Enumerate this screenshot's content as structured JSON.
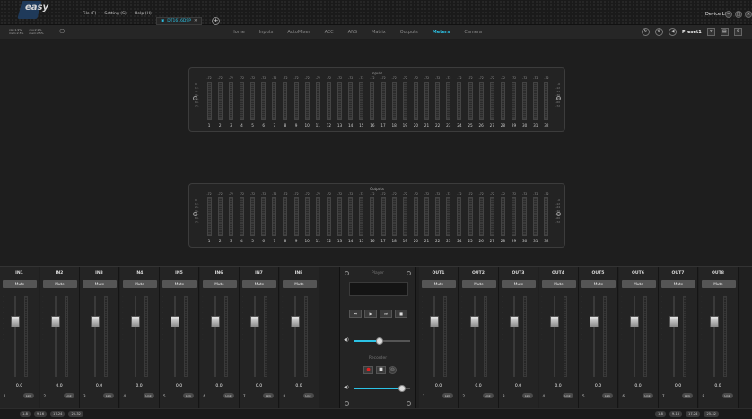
{
  "app": {
    "logo": "easy",
    "menus": [
      "File (F)",
      "Setting (S)",
      "Help (H)"
    ],
    "device_tab": "DT1616DSP",
    "device_list": "Device List"
  },
  "stats": {
    "cpu": "cpu:1.9%",
    "mem": "mem:2.5%",
    "cpu2": "cpu:2.9%",
    "mem2": "mem:2.5%"
  },
  "nav": {
    "tabs": [
      "Home",
      "Inputs",
      "AutoMixer",
      "AEC",
      "ANS",
      "Matrix",
      "Outputs",
      "Meters",
      "Camera"
    ],
    "active_tab": "Meters",
    "preset": "Preset1"
  },
  "meters": {
    "inputs_title": "Inputs",
    "outputs_title": "Outputs",
    "channel_value": "-72",
    "channel_count": 32,
    "scale_left": [
      "0-",
      "12-",
      "24-",
      "36-",
      "48-",
      "60-",
      "72-"
    ],
    "scale_right": [
      "-0",
      "-12",
      "-24",
      "-36",
      "-48",
      "-60",
      "-72"
    ]
  },
  "inputs": [
    {
      "name": "IN1",
      "value": "0.0",
      "num": "1"
    },
    {
      "name": "IN2",
      "value": "0.0",
      "num": "2"
    },
    {
      "name": "IN3",
      "value": "0.0",
      "num": "3"
    },
    {
      "name": "IN4",
      "value": "0.0",
      "num": "4"
    },
    {
      "name": "IN5",
      "value": "0.0",
      "num": "5"
    },
    {
      "name": "IN6",
      "value": "0.0",
      "num": "6"
    },
    {
      "name": "IN7",
      "value": "0.0",
      "num": "7"
    },
    {
      "name": "IN8",
      "value": "0.0",
      "num": "8"
    }
  ],
  "outputs": [
    {
      "name": "OUT1",
      "value": "0.0",
      "num": "1"
    },
    {
      "name": "OUT2",
      "value": "0.0",
      "num": "2"
    },
    {
      "name": "OUT3",
      "value": "0.0",
      "num": "3"
    },
    {
      "name": "OUT4",
      "value": "0.0",
      "num": "4"
    },
    {
      "name": "OUT5",
      "value": "0.0",
      "num": "5"
    },
    {
      "name": "OUT6",
      "value": "0.0",
      "num": "6"
    },
    {
      "name": "OUT7",
      "value": "0.0",
      "num": "7"
    },
    {
      "name": "OUT8",
      "value": "0.0",
      "num": "8"
    }
  ],
  "mute_label": "Mute",
  "link_label": "Link",
  "player": {
    "title": "Player",
    "volume": 0.45,
    "recorder_title": "Recorder",
    "rec_volume": 0.85
  },
  "status": {
    "left": [
      "1-8",
      "9-16",
      "17-24",
      "25-32"
    ],
    "right": [
      "1-8",
      "9-16",
      "17-24",
      "25-32"
    ]
  },
  "colors": {
    "accent": "#2cc3e6",
    "record": "#e02020"
  }
}
